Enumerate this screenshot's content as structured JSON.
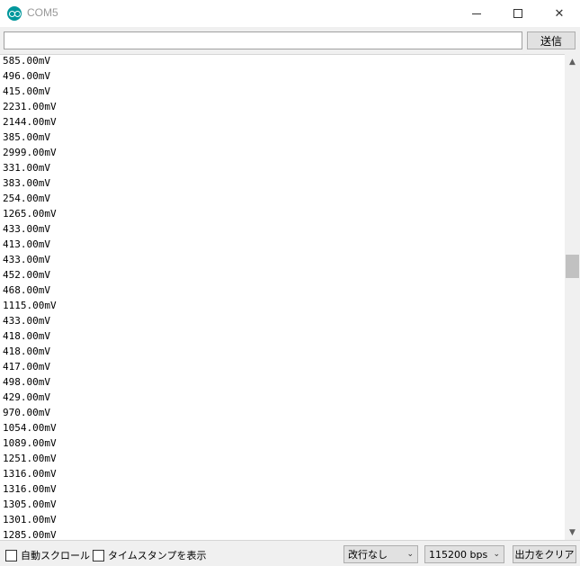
{
  "window": {
    "title": "COM5",
    "icons": {
      "app": "arduino-icon",
      "minimize": "minimize-icon",
      "maximize": "maximize-icon",
      "close": "close-icon"
    },
    "close_glyph": "✕"
  },
  "input": {
    "value": "",
    "placeholder": "",
    "send_label": "送信"
  },
  "output": {
    "lines": [
      "585.00mV",
      "496.00mV",
      "415.00mV",
      "2231.00mV",
      "2144.00mV",
      "385.00mV",
      "2999.00mV",
      "331.00mV",
      "383.00mV",
      "254.00mV",
      "1265.00mV",
      "433.00mV",
      "413.00mV",
      "433.00mV",
      "452.00mV",
      "468.00mV",
      "1115.00mV",
      "433.00mV",
      "418.00mV",
      "418.00mV",
      "417.00mV",
      "498.00mV",
      "429.00mV",
      "970.00mV",
      "1054.00mV",
      "1089.00mV",
      "1251.00mV",
      "1316.00mV",
      "1316.00mV",
      "1305.00mV",
      "1301.00mV",
      "1285.00mV"
    ]
  },
  "scrollbar": {
    "up_glyph": "▲",
    "down_glyph": "▼"
  },
  "bottom": {
    "autoscroll_label": "自動スクロール",
    "timestamp_label": "タイムスタンプを表示",
    "line_ending": "改行なし",
    "baud_rate": "115200 bps",
    "chevron_glyph": "⌄",
    "clear_label": "出力をクリア"
  },
  "colors": {
    "icon_teal": "#00979c",
    "title_text": "#999999",
    "panel_bg": "#f0f0f0",
    "button_bg": "#e1e1e1",
    "scroll_thumb": "#c1c1c1"
  }
}
